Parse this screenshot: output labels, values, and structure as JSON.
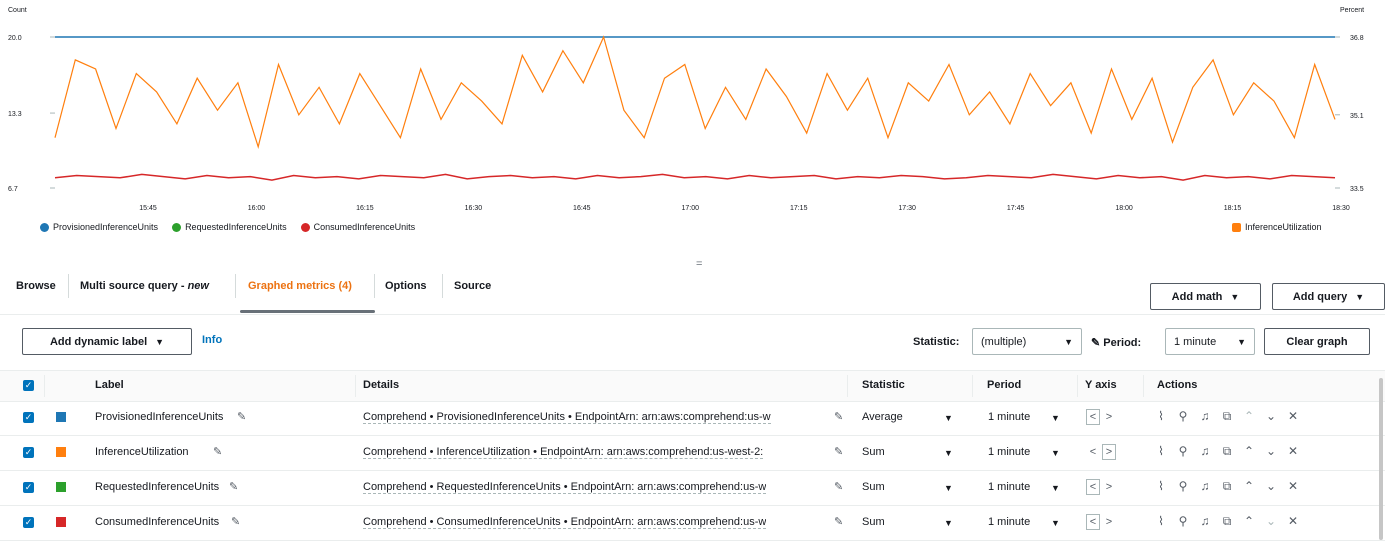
{
  "chart_data": {
    "type": "line",
    "left_axis_label": "Count",
    "right_axis_label": "Percent",
    "left_ticks": [
      "20.0",
      "13.3",
      "6.7"
    ],
    "right_ticks": [
      "36.8",
      "35.1",
      "33.5"
    ],
    "x_ticks": [
      "15:45",
      "16:00",
      "16:15",
      "16:30",
      "16:45",
      "17:00",
      "17:15",
      "17:30",
      "17:45",
      "18:00",
      "18:15",
      "18:30"
    ],
    "ylim_left": [
      6.7,
      20.0
    ],
    "ylim_right": [
      33.5,
      36.8
    ],
    "grid": false,
    "series": [
      {
        "name": "ProvisionedInferenceUnits",
        "axis": "left",
        "color": "#1f77b4",
        "values": [
          20,
          20
        ]
      },
      {
        "name": "RequestedInferenceUnits",
        "axis": "left",
        "color": "#2ca02c",
        "values": []
      },
      {
        "name": "ConsumedInferenceUnits",
        "axis": "left",
        "color": "#d62728",
        "values": [
          7.6,
          7.8,
          7.7,
          7.6,
          7.9,
          7.7,
          7.5,
          7.8,
          7.6,
          7.7,
          7.4,
          7.8,
          7.6,
          7.7,
          7.5,
          7.8,
          7.7,
          7.6,
          7.9,
          7.5,
          7.7,
          7.8,
          7.6,
          7.7,
          7.5,
          7.8,
          7.6,
          7.7,
          7.9,
          7.6,
          7.7,
          7.5,
          7.8,
          7.6,
          7.7,
          7.8,
          7.5,
          7.7,
          7.6,
          7.8,
          7.7,
          7.5,
          7.6,
          7.8,
          7.7,
          7.6,
          7.9,
          7.7,
          7.5,
          7.8,
          7.6,
          7.7,
          7.4,
          7.8,
          7.6,
          7.7,
          7.5,
          7.8,
          7.7,
          7.6
        ]
      },
      {
        "name": "InferenceUtilization",
        "axis": "right",
        "color": "#ff7f0e",
        "values": [
          34.6,
          36.3,
          36.1,
          34.8,
          36.0,
          35.6,
          34.9,
          35.9,
          35.2,
          35.8,
          34.4,
          36.2,
          35.1,
          35.7,
          34.9,
          36.0,
          35.3,
          34.6,
          36.1,
          35.0,
          35.8,
          35.4,
          34.9,
          36.4,
          35.6,
          36.5,
          35.8,
          36.8,
          35.2,
          34.6,
          35.9,
          36.2,
          34.8,
          35.7,
          35.0,
          36.1,
          35.5,
          34.7,
          36.0,
          35.2,
          35.9,
          34.6,
          35.8,
          35.4,
          36.2,
          35.1,
          35.6,
          34.9,
          36.0,
          35.3,
          35.8,
          34.7,
          36.1,
          35.0,
          35.9,
          34.5,
          35.7,
          36.3,
          35.1,
          35.8,
          35.4,
          34.6,
          36.2,
          35.0
        ]
      }
    ]
  },
  "legend_left": [
    {
      "label": "ProvisionedInferenceUnits",
      "color": "#1f77b4"
    },
    {
      "label": "RequestedInferenceUnits",
      "color": "#2ca02c"
    },
    {
      "label": "ConsumedInferenceUnits",
      "color": "#d62728"
    }
  ],
  "legend_right": {
    "label": "InferenceUtilization",
    "color": "#ff7f0e"
  },
  "resize_handle": "=",
  "tabs": {
    "browse": "Browse",
    "multi_source_query": "Multi source query - ",
    "multi_source_new": "new",
    "graphed_metrics": "Graphed metrics (4)",
    "options": "Options",
    "source": "Source",
    "active_color": "#ec7211"
  },
  "toolbar": {
    "add_math": "Add math",
    "add_query": "Add query",
    "add_dynamic_label": "Add dynamic label",
    "info": "Info",
    "statistic_label": "Statistic:",
    "statistic_value": "(multiple)",
    "period_label": "Period:",
    "period_value": "1 minute",
    "clear_graph": "Clear graph"
  },
  "table": {
    "columns": {
      "label": "Label",
      "details": "Details",
      "statistic": "Statistic",
      "period": "Period",
      "yaxis": "Y axis",
      "actions": "Actions"
    },
    "rows": [
      {
        "color": "#1f77b4",
        "label": "ProvisionedInferenceUnits",
        "details": "Comprehend • ProvisionedInferenceUnits • EndpointArn: arn:aws:comprehend:us-w",
        "statistic": "Average",
        "period": "1 minute",
        "yaxis": "left"
      },
      {
        "color": "#ff7f0e",
        "label": "InferenceUtilization",
        "details": "Comprehend • InferenceUtilization • EndpointArn: arn:aws:comprehend:us-west-2:",
        "statistic": "Sum",
        "period": "1 minute",
        "yaxis": "right"
      },
      {
        "color": "#2ca02c",
        "label": "RequestedInferenceUnits",
        "details": "Comprehend • RequestedInferenceUnits • EndpointArn: arn:aws:comprehend:us-w",
        "statistic": "Sum",
        "period": "1 minute",
        "yaxis": "left"
      },
      {
        "color": "#d62728",
        "label": "ConsumedInferenceUnits",
        "details": "Comprehend • ConsumedInferenceUnits • EndpointArn: arn:aws:comprehend:us-w",
        "statistic": "Sum",
        "period": "1 minute",
        "yaxis": "left"
      }
    ]
  }
}
